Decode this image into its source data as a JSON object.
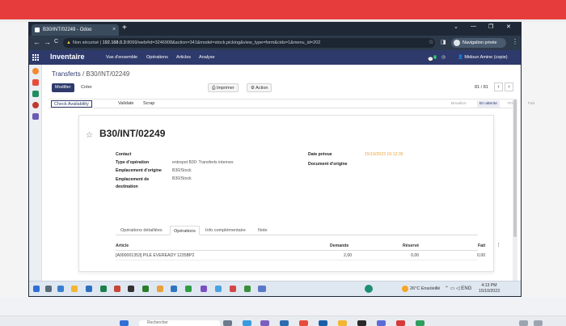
{
  "browser": {
    "tab_title": "B30/INT/02249 - Odoo",
    "tab_close": "×",
    "new_tab": "+",
    "window_min": "⌄",
    "window_restore": "—",
    "window_max": "❐",
    "window_close": "✕",
    "back": "←",
    "forward": "→",
    "reload": "C",
    "insecure_label": "Non sécurisé",
    "url_host": "192.168.0.3",
    "url_rest": ":8069/web#id=3246908&action=341&model=stock.picking&view_type=form&cids=1&menu_id=202",
    "profile_label": "Navigation privée",
    "menu_dots": "⋮"
  },
  "odoo_nav": {
    "app_title": "Inventaire",
    "menus": [
      "Vue d'ensemble",
      "Opérations",
      "Articles",
      "Analyse"
    ],
    "notif_count": "1",
    "user_name": "Midoun Amine (copie)"
  },
  "breadcrumb": {
    "parent": "Transferts",
    "separator": " / ",
    "current": "B30/INT/02249"
  },
  "control": {
    "edit_label": "Modifier",
    "create_label": "Créer",
    "print_label": "Imprimer",
    "action_label": "Action",
    "pager": "81 / 81",
    "prev": "‹",
    "next": "›"
  },
  "status": {
    "check_availability": "Check Availability",
    "validate": "Validate",
    "scrap": "Scrap",
    "stages": [
      "Brouillon",
      "En attente",
      "Prêt",
      "Fait"
    ],
    "active_stage": "En attente"
  },
  "record": {
    "name": "B30/INT/02249",
    "star": "☆",
    "fields_left": [
      {
        "label": "Contact",
        "value": ""
      },
      {
        "label": "Type d'opération",
        "value": "entrepot B30: Transferts internes"
      },
      {
        "label": "Emplacement d'origine",
        "value": "B30/Stock"
      },
      {
        "label": "Emplacement de destination",
        "value": "B30/Stock"
      }
    ],
    "fields_right": [
      {
        "label": "Date prévue",
        "value": "15/10/2023 16:12:35"
      },
      {
        "label": "Document d'origine",
        "value": ""
      }
    ]
  },
  "tabs": [
    "Opérations détaillées",
    "Opérations",
    "Info complémentaire",
    "Note"
  ],
  "active_tab": "Opérations",
  "table": {
    "headers": [
      "Article",
      "Demande",
      "Réservé",
      "Fait"
    ],
    "rows": [
      {
        "article": "[A000001353] PILE EVEREADY 1235BP2",
        "demande": "2,00",
        "reserve": "0,00",
        "fait": "0,00"
      }
    ],
    "options": "⋮"
  },
  "taskbar": {
    "weather": "26°C  Ensoleillé",
    "time": "4:13 PM",
    "date": "15/10/2023",
    "tray": "⌃ ▭ ◁ ENG"
  },
  "desktop": {
    "search_placeholder": "Rechercher"
  },
  "colors": {
    "odoo_primary": "#2e3a6b",
    "red_band": "#e73c3c",
    "date_orange": "#e8a23a"
  }
}
